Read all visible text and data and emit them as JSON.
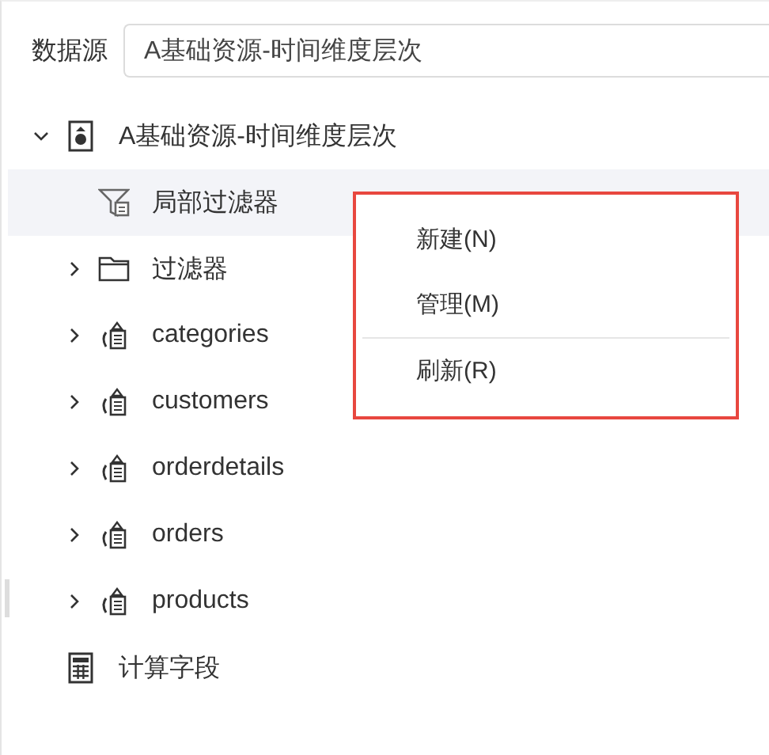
{
  "datasource": {
    "label": "数据源",
    "value": "A基础资源-时间维度层次"
  },
  "tree": [
    {
      "label": "A基础资源-时间维度层次",
      "kind": "dataset",
      "expanded": true,
      "selected": false,
      "children": [
        {
          "label": "局部过滤器",
          "kind": "local-filter",
          "selected": true
        },
        {
          "label": "过滤器",
          "kind": "folder",
          "expanded": false,
          "selected": false
        },
        {
          "label": "categories",
          "kind": "table",
          "expanded": false,
          "selected": false
        },
        {
          "label": "customers",
          "kind": "table",
          "expanded": false,
          "selected": false
        },
        {
          "label": "orderdetails",
          "kind": "table",
          "expanded": false,
          "selected": false
        },
        {
          "label": "orders",
          "kind": "table",
          "expanded": false,
          "selected": false
        },
        {
          "label": "products",
          "kind": "table",
          "expanded": false,
          "selected": false
        }
      ]
    },
    {
      "label": "计算字段",
      "kind": "calc",
      "selected": false
    }
  ],
  "context_menu": {
    "groups": [
      [
        "新建(N)",
        "管理(M)"
      ],
      [
        "刷新(R)"
      ]
    ]
  }
}
